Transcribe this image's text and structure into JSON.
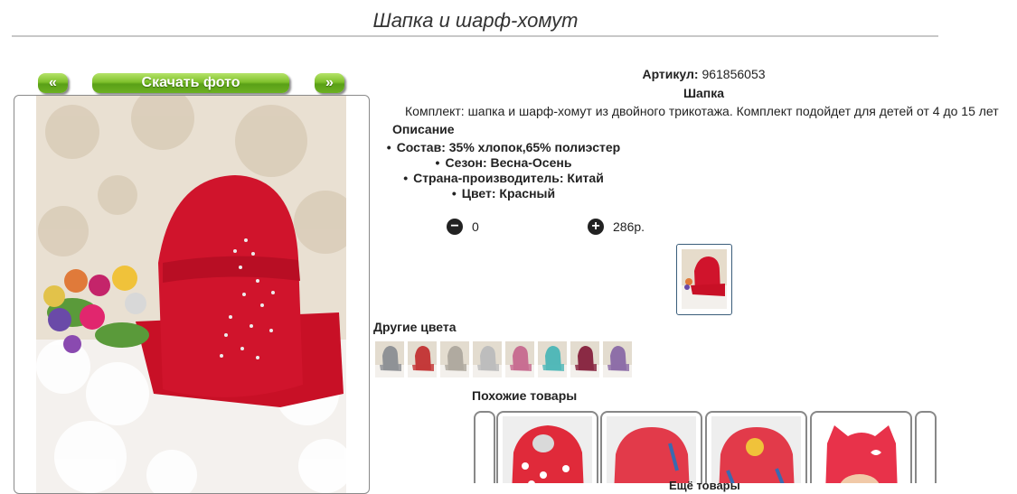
{
  "page": {
    "title": "Шапка и шарф-хомут"
  },
  "photo_nav": {
    "prev_label": "«",
    "download_label": "Скачать фото",
    "next_label": "»"
  },
  "product": {
    "sku_label": "Артикул:",
    "sku_value": "961856053",
    "name": "Шапка",
    "description": "Комплект: шапка и шарф-хомут из двойного трикотажа. Комплект подойдет для детей от 4 до 15 лет",
    "description_heading": "Описание",
    "specs": [
      "Состав: 35% хлопок,65% полиэстер",
      "Сезон: Весна-Осень",
      "Страна-производитель: Китай",
      "Цвет: Красный"
    ]
  },
  "cart": {
    "minus_symbol": "−",
    "quantity": "0",
    "plus_symbol": "+",
    "price": "286р."
  },
  "other_colors": {
    "heading": "Другие цвета",
    "swatch_colors": [
      "#8f9296",
      "#c43a3a",
      "#b0aaa0",
      "#bdbdbd",
      "#c86f92",
      "#52b8b8",
      "#8a2a44",
      "#8e6fa8"
    ]
  },
  "similar": {
    "heading": "Похожие товары",
    "more_label": "Ещё товары"
  },
  "icons": [
    "minus-circle-icon",
    "plus-circle-icon"
  ]
}
